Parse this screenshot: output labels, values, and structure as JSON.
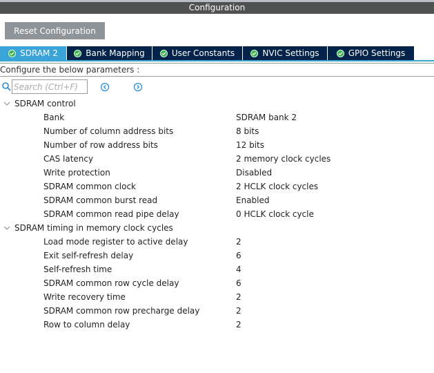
{
  "window": {
    "title": "Configuration"
  },
  "toolbar": {
    "reset_label": "Reset Configuration"
  },
  "tabs": [
    {
      "label": "SDRAM 2",
      "active": true
    },
    {
      "label": "Bank Mapping"
    },
    {
      "label": "User Constants"
    },
    {
      "label": "NVIC Settings"
    },
    {
      "label": "GPIO Settings"
    }
  ],
  "configure_text": "Configure the below parameters :",
  "search": {
    "placeholder": "Search (Ctrl+F)"
  },
  "groups": [
    {
      "label": "SDRAM control",
      "items": [
        {
          "label": "Bank",
          "value": "SDRAM bank 2"
        },
        {
          "label": "Number of column address bits",
          "value": "8 bits"
        },
        {
          "label": "Number of row address bits",
          "value": "12 bits"
        },
        {
          "label": "CAS latency",
          "value": "2 memory clock cycles"
        },
        {
          "label": "Write protection",
          "value": "Disabled"
        },
        {
          "label": "SDRAM common clock",
          "value": "2 HCLK clock cycles"
        },
        {
          "label": "SDRAM common burst read",
          "value": "Enabled"
        },
        {
          "label": "SDRAM common read pipe delay",
          "value": "0 HCLK clock cycle"
        }
      ]
    },
    {
      "label": "SDRAM timing in memory clock cycles",
      "items": [
        {
          "label": "Load mode register to active delay",
          "value": "2"
        },
        {
          "label": "Exit self-refresh delay",
          "value": "6"
        },
        {
          "label": "Self-refresh time",
          "value": "4"
        },
        {
          "label": "SDRAM common row cycle delay",
          "value": "6"
        },
        {
          "label": "Write recovery time",
          "value": "2"
        },
        {
          "label": "SDRAM common row precharge delay",
          "value": "2"
        },
        {
          "label": "Row to column delay",
          "value": "2"
        }
      ]
    }
  ],
  "colors": {
    "accent": "#3aa3d8",
    "tab_bg": "#03234b",
    "check": "#3bb54a",
    "title_bg": "#505251"
  }
}
